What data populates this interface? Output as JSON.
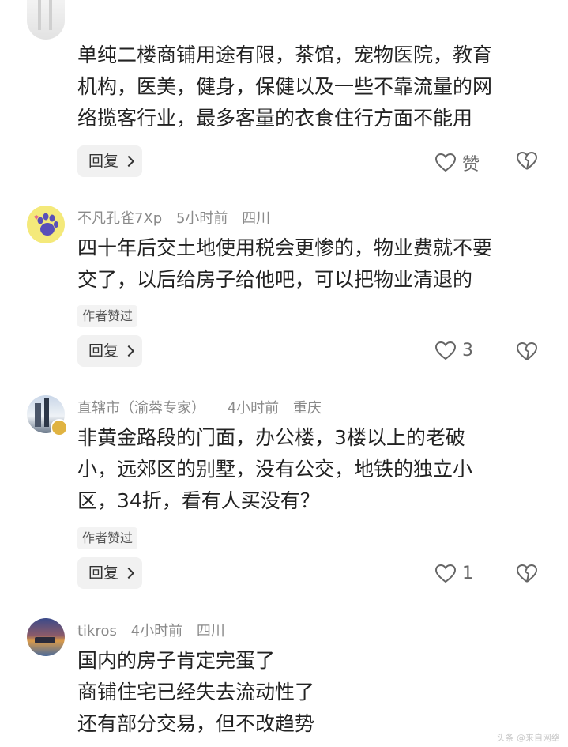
{
  "comments": [
    {
      "lines": [
        "单纯二楼商铺用途有限，茶馆，宠物医院，教育",
        "机构，医美，健身，保健以及一些不靠流量的网",
        "络揽客行业，最多客量的衣食住行方面不能用"
      ],
      "reply_label": "回复",
      "like_text": "赞"
    },
    {
      "username": "不凡孔雀7Xp",
      "time": "5小时前",
      "location": "四川",
      "lines": [
        "四十年后交土地使用税会更惨的，物业费就不要",
        "交了，以后给房子给他吧，可以把物业清退的"
      ],
      "badge": "作者赞过",
      "reply_label": "回复",
      "like_text": "3"
    },
    {
      "username": "直辖市（渝蓉专家）",
      "time": "4小时前",
      "location": "重庆",
      "lines": [
        "非黄金路段的门面，办公楼，3楼以上的老破",
        "小，远郊区的别墅，没有公交，地铁的独立小",
        "区，34折，看有人买没有？"
      ],
      "badge": "作者赞过",
      "reply_label": "回复",
      "like_text": "1"
    },
    {
      "username": "tikros",
      "time": "4小时前",
      "location": "四川",
      "lines": [
        "国内的房子肯定完蛋了",
        "商铺住宅已经失去流动性了",
        "还有部分交易，但不改趋势"
      ]
    }
  ],
  "watermark": "头条 @来自网络",
  "colors": {
    "meta": "#8a8a8a",
    "text": "#222222",
    "chip_bg": "#f1f1f1"
  }
}
